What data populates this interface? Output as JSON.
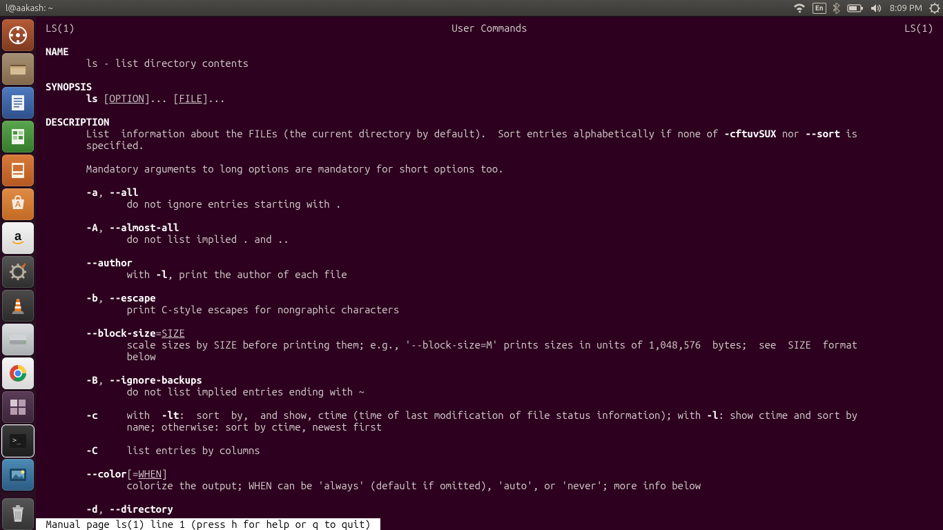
{
  "topbar": {
    "title": "l@aakash: ~",
    "language_indicator": "En",
    "clock": "8:09 PM"
  },
  "man": {
    "header_left": "LS(1)",
    "header_center": "User Commands",
    "header_right": "LS(1)",
    "section_name": "NAME",
    "name_line": "ls - list directory contents",
    "section_synopsis": "SYNOPSIS",
    "syn_cmd": "ls",
    "syn_open1": " [",
    "syn_option": "OPTION",
    "syn_mid": "]... [",
    "syn_file": "FILE",
    "syn_close": "]...",
    "section_description": "DESCRIPTION",
    "desc_0": "List  information about the FILEs (the current directory by default).  Sort entries alphabetically if none of ",
    "desc_cftuv": "-cftuvSUX",
    "desc_nor": " nor ",
    "desc_sort": "--sort",
    "desc_is": " is",
    "desc_1": "specified.",
    "desc_2": "Mandatory arguments to long options are mandatory for short options too.",
    "opt_a": "-a",
    "comma": ", ",
    "opt_all": "--all",
    "txt_a": "do not ignore entries starting with .",
    "opt_A": "-A",
    "opt_almost": "--almost-all",
    "txt_A": "do not list implied . and ..",
    "opt_author": "--author",
    "txt_author_pre": "with ",
    "opt_l": "-l",
    "txt_author_post": ", print the author of each file",
    "opt_b": "-b",
    "opt_escape": "--escape",
    "txt_b": "print C-style escapes for nongraphic characters",
    "opt_block": "--block-size",
    "eq": "=",
    "size_u": "SIZE",
    "txt_block_1": "scale sizes by SIZE before printing them; e.g., '--block-size=M' prints sizes in units of 1,048,576  bytes;  see  SIZE  format",
    "txt_block_2": "below",
    "opt_B": "-B",
    "opt_ignore": "--ignore-backups",
    "txt_B": "do not list implied entries ending with ~",
    "opt_c": "-c",
    "txt_c_pre": "     with  ",
    "opt_lt": "-lt",
    "txt_c_mid": ":  sort  by,  and show, ctime (time of last modification of file status information); with ",
    "txt_c_post": ": show ctime and sort by",
    "txt_c_2": "name; otherwise: sort by ctime, newest first",
    "opt_C": "-C",
    "txt_C": "     list entries by columns",
    "opt_color": "--color",
    "opt_color_arg_open": "[=",
    "when_u": "WHEN",
    "opt_color_arg_close": "]",
    "txt_color": "colorize the output; WHEN can be 'always' (default if omitted), 'auto', or 'never'; more info below",
    "opt_d": "-d",
    "opt_directory": "--directory",
    "status": " Manual page ls(1) line 1 (press h for help or q to quit) "
  }
}
